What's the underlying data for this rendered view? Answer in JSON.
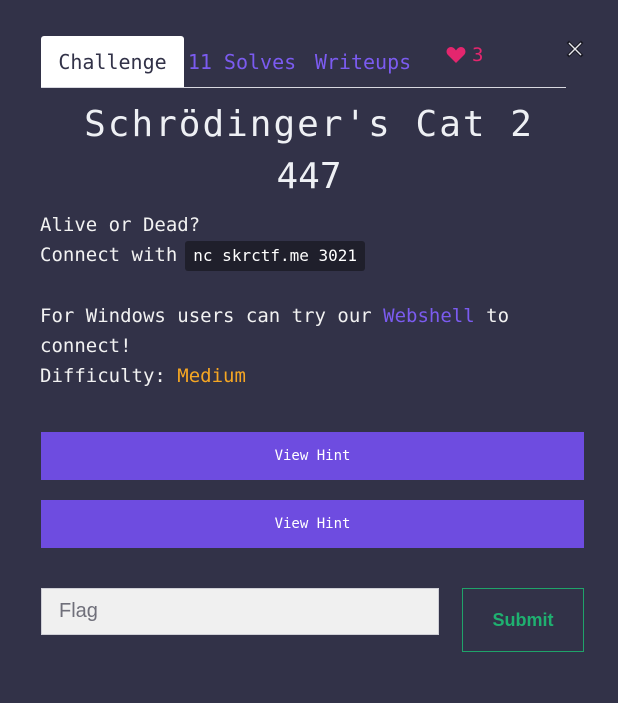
{
  "tabs": {
    "challenge": "Challenge",
    "solves": "11 Solves",
    "writeups": "Writeups"
  },
  "likes": {
    "count": "3",
    "icon": "heart-icon",
    "color": "#e4266e"
  },
  "close": {
    "icon": "close-icon"
  },
  "challenge": {
    "title": "Schrödinger's Cat 2",
    "points": "447",
    "description": {
      "line1": "Alive or Dead?",
      "connect_prefix": "Connect with",
      "command": "nc skrctf.me 3021",
      "windows_prefix": "For Windows users can try our ",
      "webshell_link": "Webshell",
      "windows_suffix": " to connect!"
    },
    "difficulty_label": "Difficulty:",
    "difficulty_value": "Medium"
  },
  "hints": [
    {
      "label": "View Hint"
    },
    {
      "label": "View Hint"
    }
  ],
  "flag_form": {
    "placeholder": "Flag",
    "submit_label": "Submit"
  },
  "colors": {
    "background": "#323248",
    "accent": "#6e4ce0",
    "link": "#7b5bf0",
    "difficulty": "#f5a623",
    "submit": "#1fb070"
  }
}
